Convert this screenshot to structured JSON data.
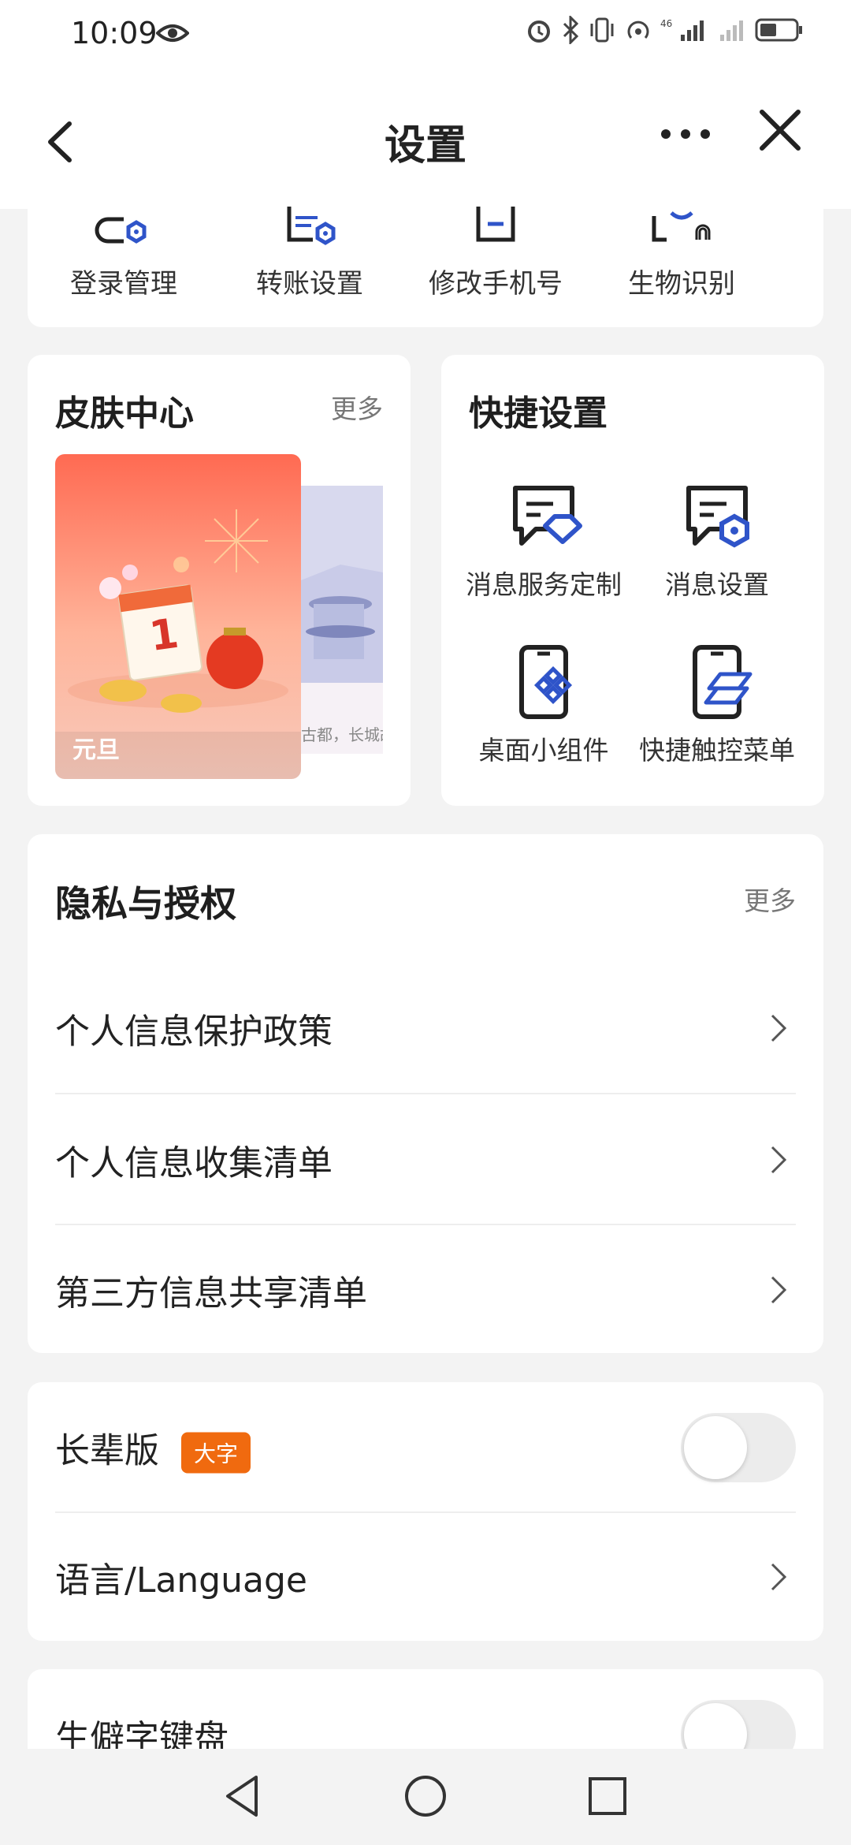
{
  "status_bar": {
    "time": "10:09",
    "battery_icon": "battery-icon"
  },
  "header": {
    "title": "设置"
  },
  "quick_row": {
    "items": [
      {
        "label": "登录管理",
        "icon": "login-manage-icon"
      },
      {
        "label": "转账设置",
        "icon": "transfer-settings-icon"
      },
      {
        "label": "修改手机号",
        "icon": "change-phone-icon"
      },
      {
        "label": "生物识别",
        "icon": "biometric-icon"
      }
    ]
  },
  "skin_center": {
    "title": "皮肤中心",
    "more": "更多",
    "card1_label": "元旦",
    "card2_caption": "古都，长城故"
  },
  "quick_settings": {
    "title": "快捷设置",
    "items": [
      {
        "label": "消息服务定制",
        "icon": "message-service-icon"
      },
      {
        "label": "消息设置",
        "icon": "message-settings-icon"
      },
      {
        "label": "桌面小组件",
        "icon": "desktop-widget-icon"
      },
      {
        "label": "快捷触控菜单",
        "icon": "quick-touch-menu-icon"
      }
    ]
  },
  "privacy": {
    "title": "隐私与授权",
    "more": "更多",
    "items": [
      {
        "label": "个人信息保护政策"
      },
      {
        "label": "个人信息收集清单"
      },
      {
        "label": "第三方信息共享清单"
      }
    ]
  },
  "elder": {
    "label": "长辈版",
    "badge": "大字",
    "toggle_on": false,
    "language_label": "语言/Language"
  },
  "keyboard": {
    "label": "生僻字键盘",
    "toggle_on": false
  },
  "colors": {
    "accent": "#2f54c9",
    "badge": "#f06a0f",
    "background": "#f3f3f3"
  }
}
